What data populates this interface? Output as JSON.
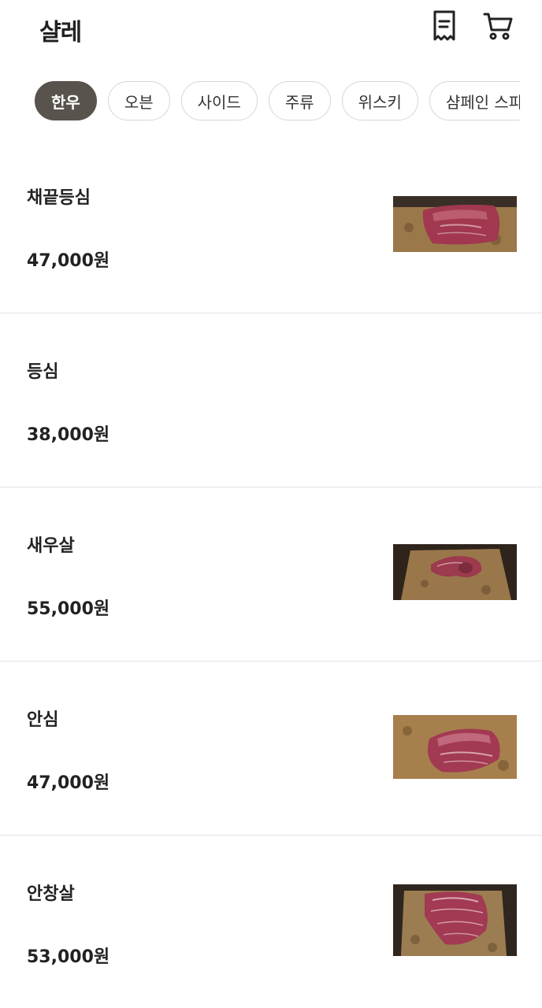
{
  "header": {
    "title": "샬레",
    "receipt_icon": "receipt-icon",
    "cart_icon": "cart-icon"
  },
  "categories": [
    {
      "label": "한우",
      "active": true
    },
    {
      "label": "오븐",
      "active": false
    },
    {
      "label": "사이드",
      "active": false
    },
    {
      "label": "주류",
      "active": false
    },
    {
      "label": "위스키",
      "active": false
    },
    {
      "label": "샴페인 스파",
      "active": false
    }
  ],
  "menu": [
    {
      "name": "채끝등심",
      "price": "47,000원",
      "has_photo": true
    },
    {
      "name": "등심",
      "price": "38,000원",
      "has_photo": false
    },
    {
      "name": "새우살",
      "price": "55,000원",
      "has_photo": true
    },
    {
      "name": "안심",
      "price": "47,000원",
      "has_photo": true
    },
    {
      "name": "안창살",
      "price": "53,000원",
      "has_photo": true
    }
  ],
  "colors": {
    "active_tab_bg": "#58534d",
    "divider": "#e3e3e3",
    "text": "#222222"
  }
}
